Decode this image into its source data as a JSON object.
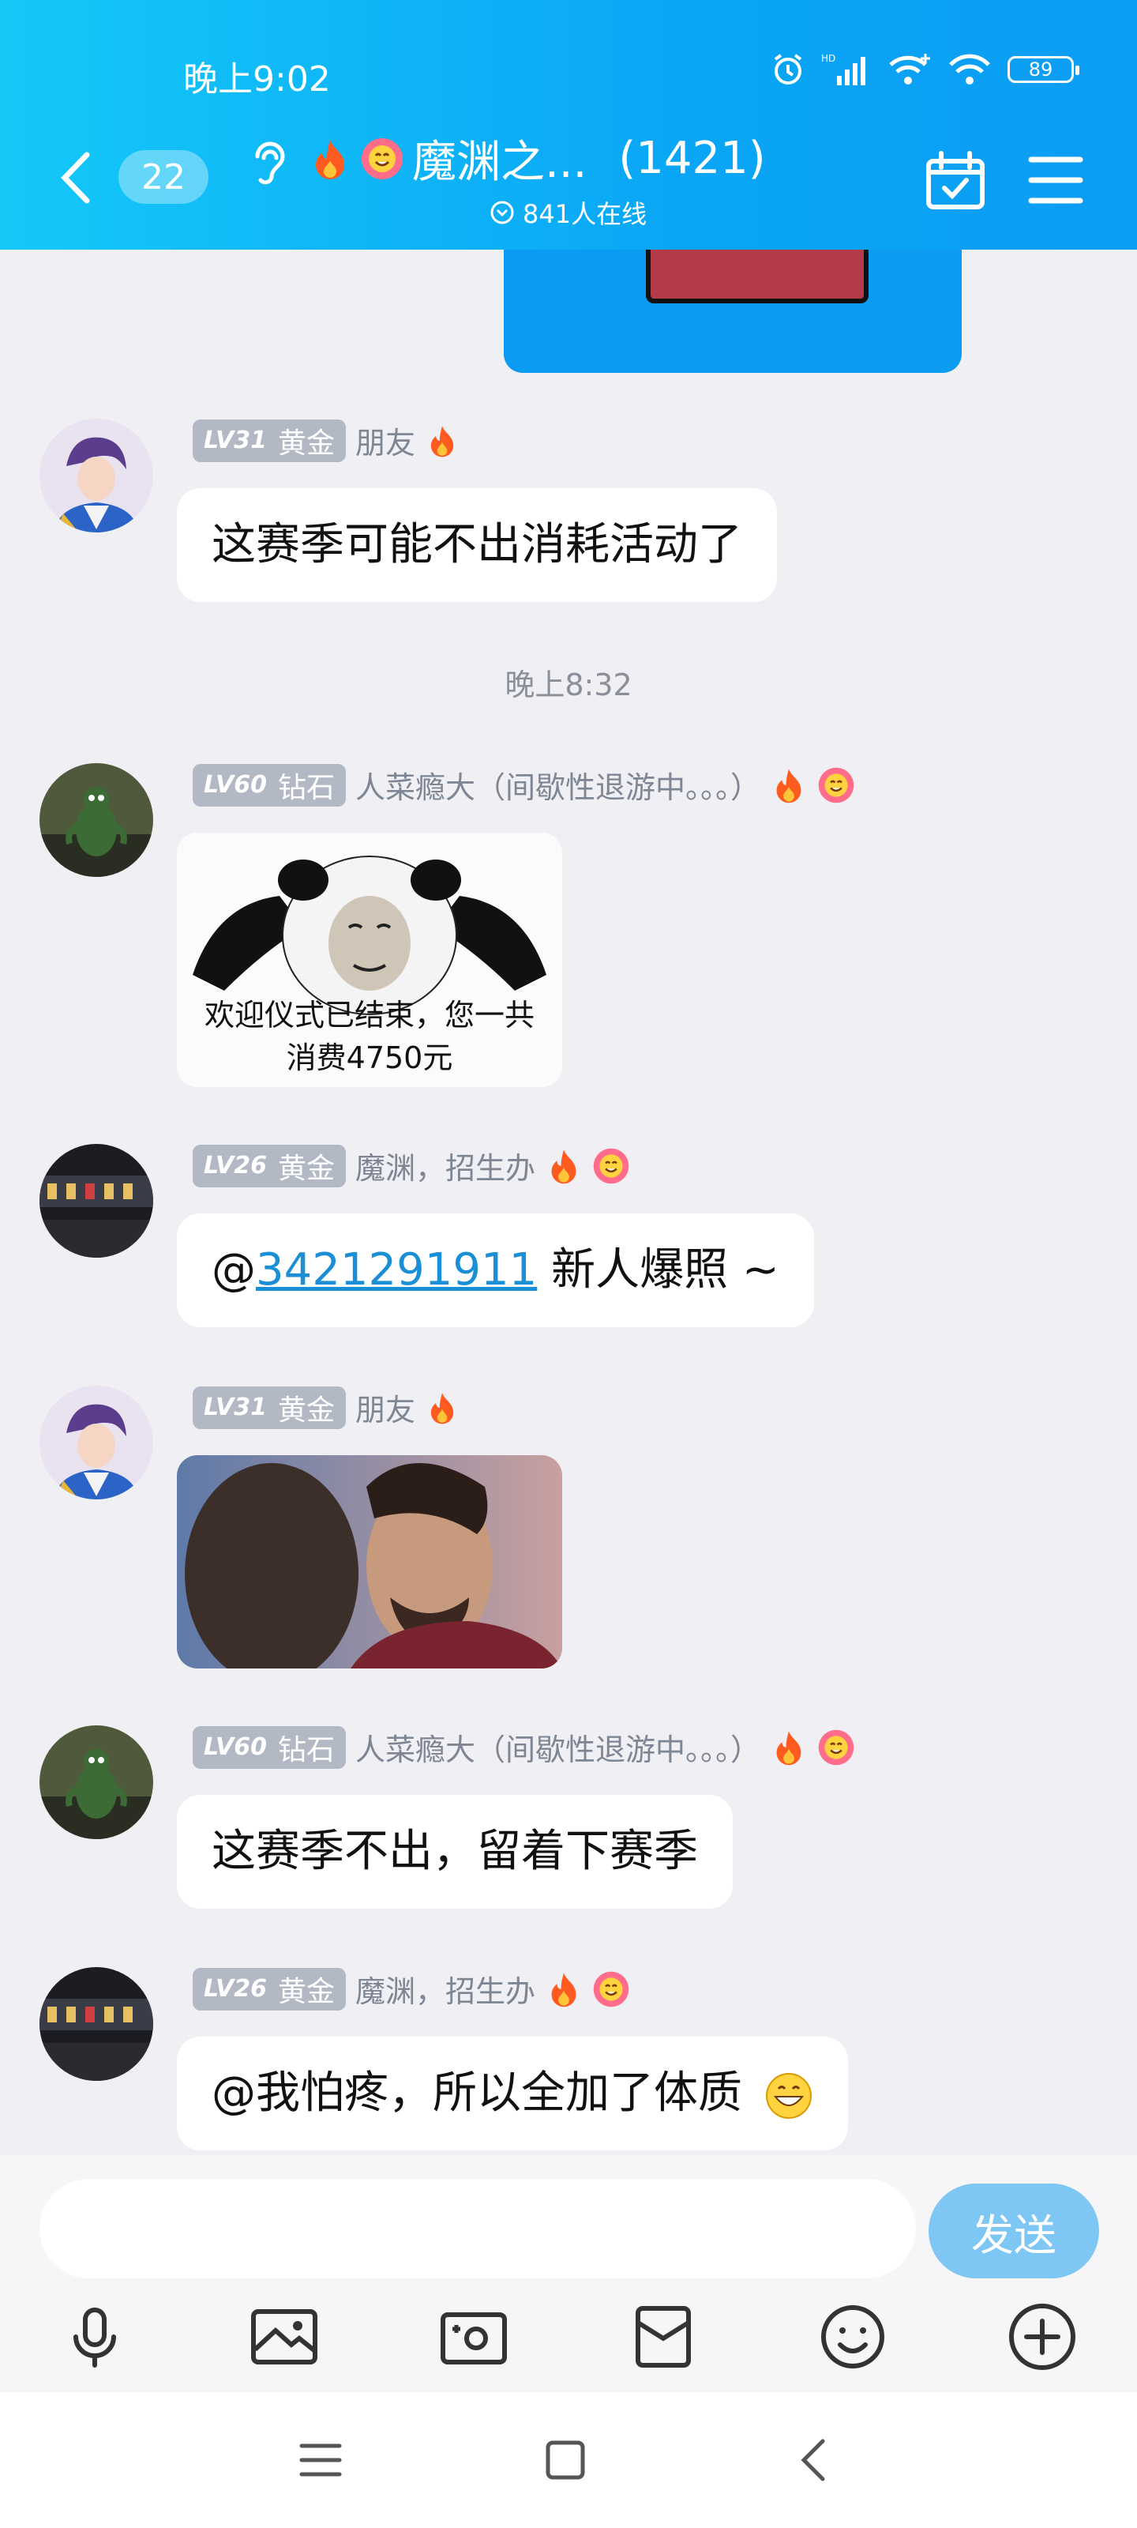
{
  "status": {
    "time": "晚上9:02",
    "battery": "89"
  },
  "header": {
    "unread": "22",
    "title": "魔渊之...",
    "count": "(1421)",
    "online": "841人在线"
  },
  "time_separator": "晚上8:32",
  "messages": [
    {
      "level": "LV31",
      "tier": "黄金",
      "name": "朋友",
      "text": "这赛季可能不出消耗活动了"
    },
    {
      "level": "LV60",
      "tier": "钻石",
      "name": "人菜瘾大（间歇性退游中。。。）",
      "image_caption_1": "欢迎仪式已结束，您一共",
      "image_caption_2": "消费4750元"
    },
    {
      "level": "LV26",
      "tier": "黄金",
      "name": "魔渊，招生办",
      "mention": "@",
      "mention_link": "3421291911",
      "text": " 新人爆照 ~"
    },
    {
      "level": "LV31",
      "tier": "黄金",
      "name": "朋友"
    },
    {
      "level": "LV60",
      "tier": "钻石",
      "name": "人菜瘾大（间歇性退游中。。。）",
      "text": "这赛季不出，留着下赛季"
    },
    {
      "level": "LV26",
      "tier": "黄金",
      "name": "魔渊，招生办",
      "text": "@我怕疼，所以全加了体质"
    }
  ],
  "input": {
    "send_label": "发送"
  },
  "colors": {
    "header_start": "#14c8f8",
    "header_end": "#0c9df4",
    "send": "#7ec6f4",
    "link": "#1a8fd6"
  }
}
